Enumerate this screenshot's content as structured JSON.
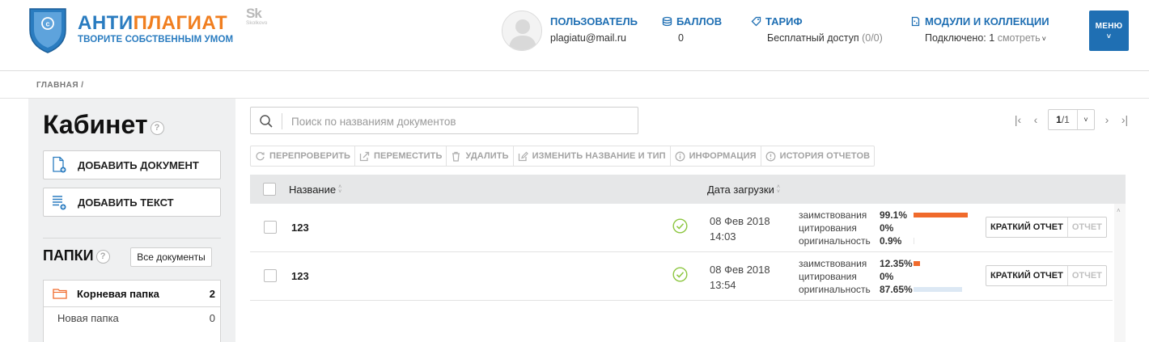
{
  "header": {
    "logo": {
      "title_part1": "АНТИ",
      "title_part2": "ПЛАГИАТ",
      "subtitle": "ТВОРИТЕ СОБСТВЕННЫМ УМОМ"
    },
    "partner": {
      "mark": "Sk",
      "text": "Skolkovo"
    },
    "user": {
      "label": "ПОЛЬЗОВАТЕЛЬ",
      "email": "plagiatu@mail.ru"
    },
    "points": {
      "label": "БАЛЛОВ",
      "value": "0"
    },
    "tariff": {
      "label": "ТАРИФ",
      "value": "Бесплатный доступ",
      "quota": "(0/0)"
    },
    "modules": {
      "label": "МОДУЛИ И КОЛЛЕКЦИИ",
      "connected_label": "Подключено:",
      "connected_count": "1",
      "view_link": "смотреть"
    },
    "menu_label": "МЕНЮ"
  },
  "breadcrumb": {
    "home": "ГЛАВНАЯ",
    "separator": "/"
  },
  "sidebar": {
    "title": "Кабинет",
    "add_document": "ДОБАВИТЬ ДОКУМЕНТ",
    "add_text": "ДОБАВИТЬ ТЕКСТ",
    "folders_title": "ПАПКИ",
    "all_documents": "Все документы",
    "folders": [
      {
        "name": "Корневая папка",
        "count": "2"
      },
      {
        "name": "Новая папка",
        "count": "0"
      }
    ]
  },
  "search": {
    "placeholder": "Поиск по названиям документов",
    "value": ""
  },
  "pager": {
    "current": "1",
    "total": "/1"
  },
  "toolbar": {
    "recheck": "ПЕРЕПРОВЕРИТЬ",
    "move": "ПЕРЕМЕСТИТЬ",
    "delete": "УДАЛИТЬ",
    "rename": "ИЗМЕНИТЬ НАЗВАНИЕ И ТИП",
    "info": "ИНФОРМАЦИЯ",
    "history": "ИСТОРИЯ ОТЧЕТОВ"
  },
  "table": {
    "col_name": "Название",
    "col_date": "Дата загрузки",
    "rows": [
      {
        "name": "123",
        "date": "08 Фев 2018",
        "time": "14:03",
        "borrow_label": "заимствования",
        "borrow": "99.1%",
        "borrow_pct": 99.1,
        "cite_label": "цитирования",
        "cite": "0%",
        "orig_label": "оригинальность",
        "orig": "0.9%",
        "orig_pct": 0.9,
        "short_report": "КРАТКИЙ ОТЧЕТ",
        "report": "ОТЧЕТ"
      },
      {
        "name": "123",
        "date": "08 Фев 2018",
        "time": "13:54",
        "borrow_label": "заимствования",
        "borrow": "12.35%",
        "borrow_pct": 12.35,
        "cite_label": "цитирования",
        "cite": "0%",
        "orig_label": "оригинальность",
        "orig": "87.65%",
        "orig_pct": 87.65,
        "short_report": "КРАТКИЙ ОТЧЕТ",
        "report": "ОТЧЕТ"
      }
    ]
  },
  "colors": {
    "brand_blue": "#1f6fb3",
    "brand_orange": "#f07e1f",
    "borrow_bar": "#f06a2b",
    "orig_bar": "#dce8f4",
    "status_ok": "#8cc63f"
  }
}
